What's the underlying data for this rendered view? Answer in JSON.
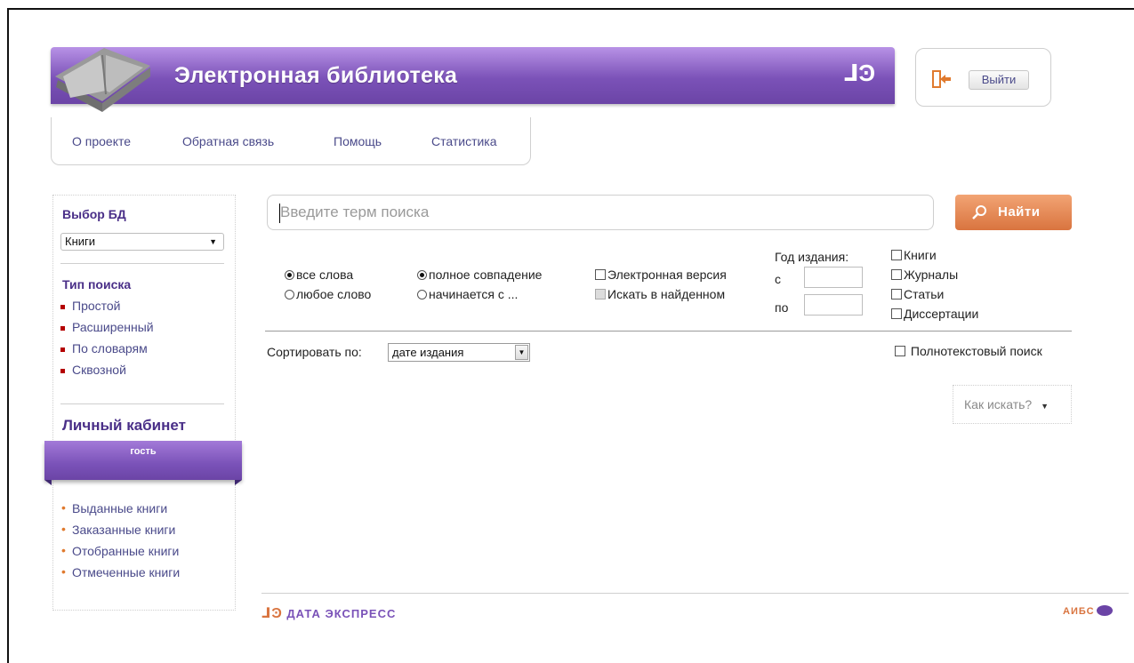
{
  "header": {
    "title": "Электронная библиотека",
    "logo_mark": "⅃Ͽ",
    "logout_label": "Выйти"
  },
  "topnav": {
    "items": [
      "О проекте",
      "Обратная связь",
      "Помощь",
      "Статистика"
    ]
  },
  "sidebar": {
    "db_heading": "Выбор БД",
    "db_selected": "Книги",
    "search_type_heading": "Тип поиска",
    "search_types": [
      "Простой",
      "Расширенный",
      "По словарям",
      "Сквозной"
    ],
    "cabinet_title": "Личный кабинет",
    "user_name": "гость",
    "cabinet_links": [
      "Выданные книги",
      "Заказанные книги",
      "Отобранные книги",
      "Отмеченные книги"
    ]
  },
  "search": {
    "placeholder": "Введите терм поиска",
    "button_label": "Найти",
    "word_modes": [
      {
        "label": "все слова",
        "selected": true
      },
      {
        "label": "любое слово",
        "selected": false
      }
    ],
    "match_modes": [
      {
        "label": "полное совпадение",
        "selected": true
      },
      {
        "label": "начинается с ...",
        "selected": false
      }
    ],
    "electronic_version": "Электронная версия",
    "search_in_found": "Искать в найденном",
    "year_label": "Год издания:",
    "year_from_label": "с",
    "year_to_label": "по",
    "doc_types": [
      "Книги",
      "Журналы",
      "Статьи",
      "Диссертации"
    ],
    "sort_label": "Сортировать по:",
    "sort_selected": "дате издания",
    "fulltext_label": "Полнотекстовый поиск",
    "howto_label": "Как искать?"
  },
  "footer": {
    "left_logo": "ДАТА ЭКСПРЕСС",
    "right_logo": "АИБС"
  },
  "colors": {
    "brand_purple": "#7b52b8",
    "accent_orange": "#d9743f",
    "link": "#4a4a8a"
  }
}
